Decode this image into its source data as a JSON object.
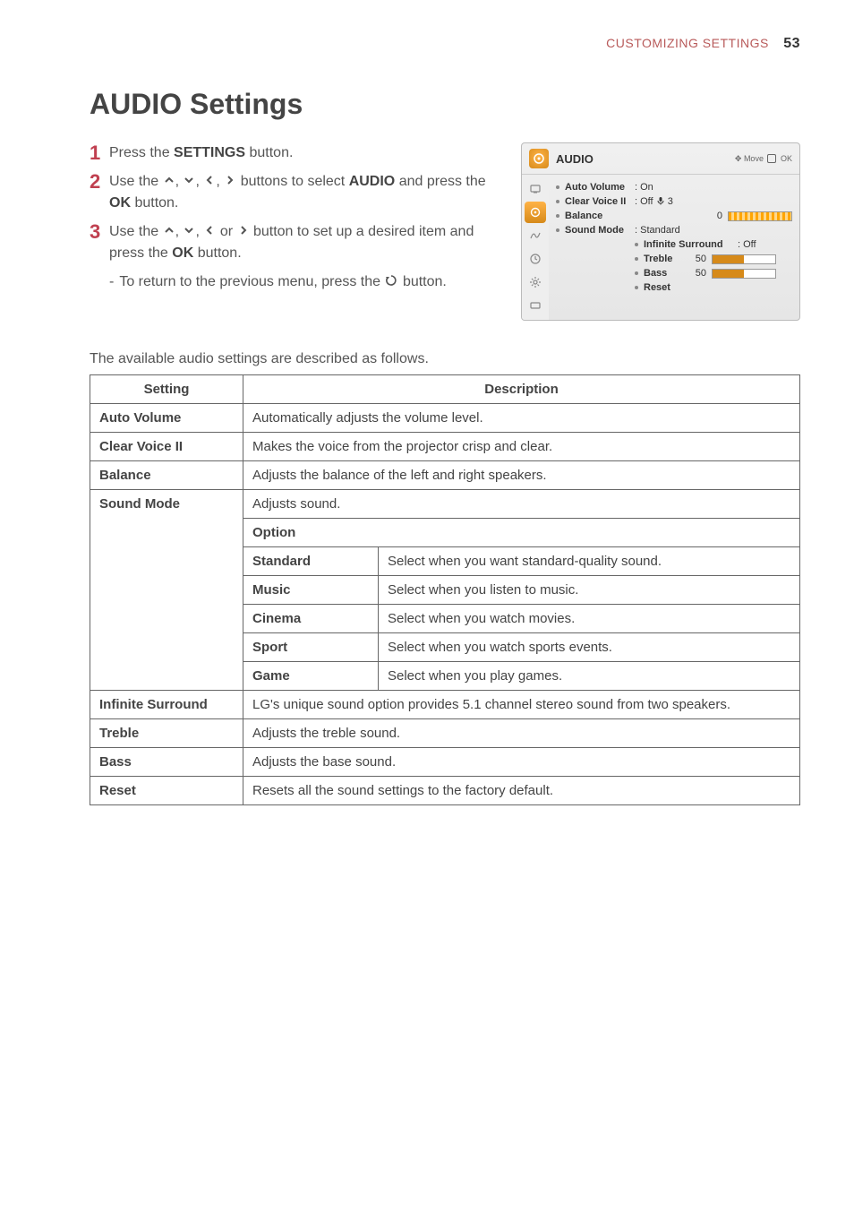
{
  "page": {
    "section": "CUSTOMIZING SETTINGS",
    "number": "53"
  },
  "heading": "AUDIO Settings",
  "steps": {
    "s1": {
      "num": "1",
      "a": "Press the ",
      "b": "SETTINGS",
      "c": " button."
    },
    "s2": {
      "num": "2",
      "a": "Use the ",
      "b": "buttons to select ",
      "c": "AUDIO",
      "d": " and press the ",
      "e": "OK",
      "f": " button."
    },
    "s3": {
      "num": "3",
      "a": "Use the ",
      "b": " button to set up a desired item and press the ",
      "c": "OK",
      "d": " button.",
      "or": "or"
    },
    "sub": {
      "a": "To return to the previous menu, press the ",
      "b": " button."
    }
  },
  "osd": {
    "title": "AUDIO",
    "hint_move": "Move",
    "hint_ok": "OK",
    "rows": {
      "auto_volume": {
        "label": "Auto Volume",
        "val": ": On"
      },
      "clear_voice": {
        "label": "Clear Voice II",
        "val": ": Off",
        "val2": "3"
      },
      "balance": {
        "label": "Balance",
        "num": "0"
      },
      "sound_mode": {
        "label": "Sound Mode",
        "val": ": Standard"
      },
      "infinite": {
        "label": "Infinite Surround",
        "val": ": Off"
      },
      "treble": {
        "label": "Treble",
        "num": "50"
      },
      "bass": {
        "label": "Bass",
        "num": "50"
      },
      "reset": {
        "label": "Reset"
      }
    }
  },
  "intro": "The available audio settings are described as follows.",
  "table": {
    "h_setting": "Setting",
    "h_desc": "Description",
    "rows": {
      "auto_volume": {
        "name": "Auto Volume",
        "desc": "Automatically adjusts the volume level."
      },
      "clear_voice": {
        "name": "Clear Voice II",
        "desc": "Makes the voice from the projector crisp and clear."
      },
      "balance": {
        "name": "Balance",
        "desc": "Adjusts the balance of the left and right speakers."
      },
      "sound_mode": {
        "name": "Sound Mode",
        "desc": "Adjusts sound."
      },
      "option_header": "Option",
      "opt_standard": {
        "name": "Standard",
        "desc": "Select when you want standard-quality sound."
      },
      "opt_music": {
        "name": "Music",
        "desc": "Select when you listen to music."
      },
      "opt_cinema": {
        "name": "Cinema",
        "desc": "Select when you watch movies."
      },
      "opt_sport": {
        "name": "Sport",
        "desc": "Select when you watch sports events."
      },
      "opt_game": {
        "name": "Game",
        "desc": "Select when you play games."
      },
      "infinite": {
        "name": "Infinite Surround",
        "desc": "LG's unique sound option provides 5.1 channel stereo sound from two speakers."
      },
      "treble": {
        "name": "Treble",
        "desc": "Adjusts the treble sound."
      },
      "bass": {
        "name": "Bass",
        "desc": "Adjusts the base sound."
      },
      "reset": {
        "name": "Reset",
        "desc": "Resets all the sound settings to the factory default."
      }
    }
  }
}
